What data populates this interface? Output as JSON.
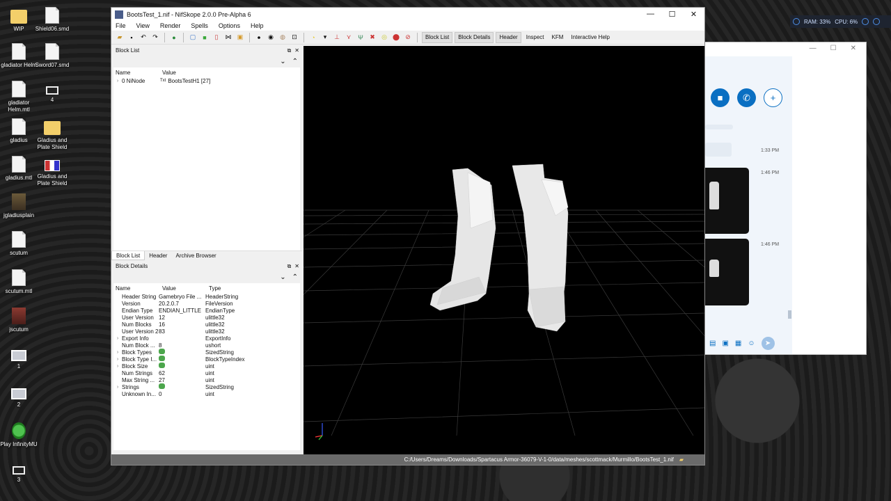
{
  "desktop": {
    "icons": [
      {
        "label": "WIP",
        "kind": "folder"
      },
      {
        "label": "Shield06.smd",
        "kind": "doc"
      },
      {
        "label": "gladiator Helm",
        "kind": "doc"
      },
      {
        "label": "Sword07.smd",
        "kind": "doc"
      },
      {
        "label": "gladiator Helm.mtl",
        "kind": "doc"
      },
      {
        "label": "4",
        "kind": "blk"
      },
      {
        "label": "gladius",
        "kind": "doc"
      },
      {
        "label": "Gladius and Plate Shield",
        "kind": "folder"
      },
      {
        "label": "gladius.mtl",
        "kind": "doc"
      },
      {
        "label": "Gladius and Plate Shield",
        "kind": "flag"
      },
      {
        "label": "jgladiusplain",
        "kind": "photo"
      },
      {
        "label": "scutum",
        "kind": "doc"
      },
      {
        "label": "scutum.mtl",
        "kind": "doc"
      },
      {
        "label": "jscutum",
        "kind": "red"
      },
      {
        "label": "1",
        "kind": "screen"
      },
      {
        "label": "2",
        "kind": "screen"
      },
      {
        "label": "Play InfinityMU",
        "kind": "game"
      },
      {
        "label": "3",
        "kind": "blk"
      }
    ]
  },
  "tray": {
    "ram": "RAM: 33%",
    "cpu": "CPU: 6%"
  },
  "chat": {
    "titlebar": {
      "minimize": "—",
      "maximize": "☐",
      "close": "✕"
    },
    "times": [
      "1:33 PM",
      "1:46 PM",
      "1:46 PM"
    ]
  },
  "nifskope": {
    "title": "BootsTest_1.nif - NifSkope 2.0.0 Pre-Alpha 6",
    "window_controls": {
      "minimize": "—",
      "maximize": "☐",
      "close": "✕"
    },
    "menu": [
      "File",
      "View",
      "Render",
      "Spells",
      "Options",
      "Help"
    ],
    "toolbar_text_buttons": [
      "Block List",
      "Block Details",
      "Header",
      "Inspect",
      "KFM",
      "Interactive Help"
    ],
    "block_list": {
      "panel_title": "Block List",
      "columns": [
        "Name",
        "Value"
      ],
      "rows": [
        {
          "name": "0 NiNode",
          "value": "BootsTestH1 [27]",
          "value_prefix": "Txt"
        }
      ]
    },
    "tabs": [
      "Block List",
      "Header",
      "Archive Browser"
    ],
    "block_details": {
      "panel_title": "Block Details",
      "columns": [
        "Name",
        "Value",
        "Type"
      ],
      "rows": [
        {
          "name": "Header String",
          "value": "Gamebryo File ...",
          "type": "HeaderString",
          "expandable": false
        },
        {
          "name": "Version",
          "value": "20.2.0.7",
          "type": "FileVersion",
          "expandable": false
        },
        {
          "name": "Endian Type",
          "value": "ENDIAN_LITTLE",
          "type": "EndianType",
          "expandable": false
        },
        {
          "name": "User Version",
          "value": "12",
          "type": "ulittle32",
          "expandable": false
        },
        {
          "name": "Num Blocks",
          "value": "16",
          "type": "ulittle32",
          "expandable": false
        },
        {
          "name": "User Version 2",
          "value": "83",
          "type": "ulittle32",
          "expandable": false
        },
        {
          "name": "Export Info",
          "value": "",
          "type": "ExportInfo",
          "expandable": true
        },
        {
          "name": "Num Block ...",
          "value": "8",
          "type": "ushort",
          "expandable": false
        },
        {
          "name": "Block Types",
          "value": "",
          "type": "SizedString",
          "expandable": true,
          "icon": true
        },
        {
          "name": "Block Type I...",
          "value": "",
          "type": "BlockTypeIndex",
          "expandable": true,
          "icon": true
        },
        {
          "name": "Block Size",
          "value": "",
          "type": "uint",
          "expandable": true,
          "icon": true
        },
        {
          "name": "Num Strings",
          "value": "62",
          "type": "uint",
          "expandable": false
        },
        {
          "name": "Max String ...",
          "value": "27",
          "type": "uint",
          "expandable": false
        },
        {
          "name": "Strings",
          "value": "",
          "type": "SizedString",
          "expandable": true,
          "icon": true
        },
        {
          "name": "Unknown In...",
          "value": "0",
          "type": "uint",
          "expandable": false
        }
      ]
    },
    "status_path": "C:/Users/Dreams/Downloads/Spartacus Armor-36079-V-1-0/data/meshes/scottmack/Murmillo/BootsTest_1.nif"
  }
}
